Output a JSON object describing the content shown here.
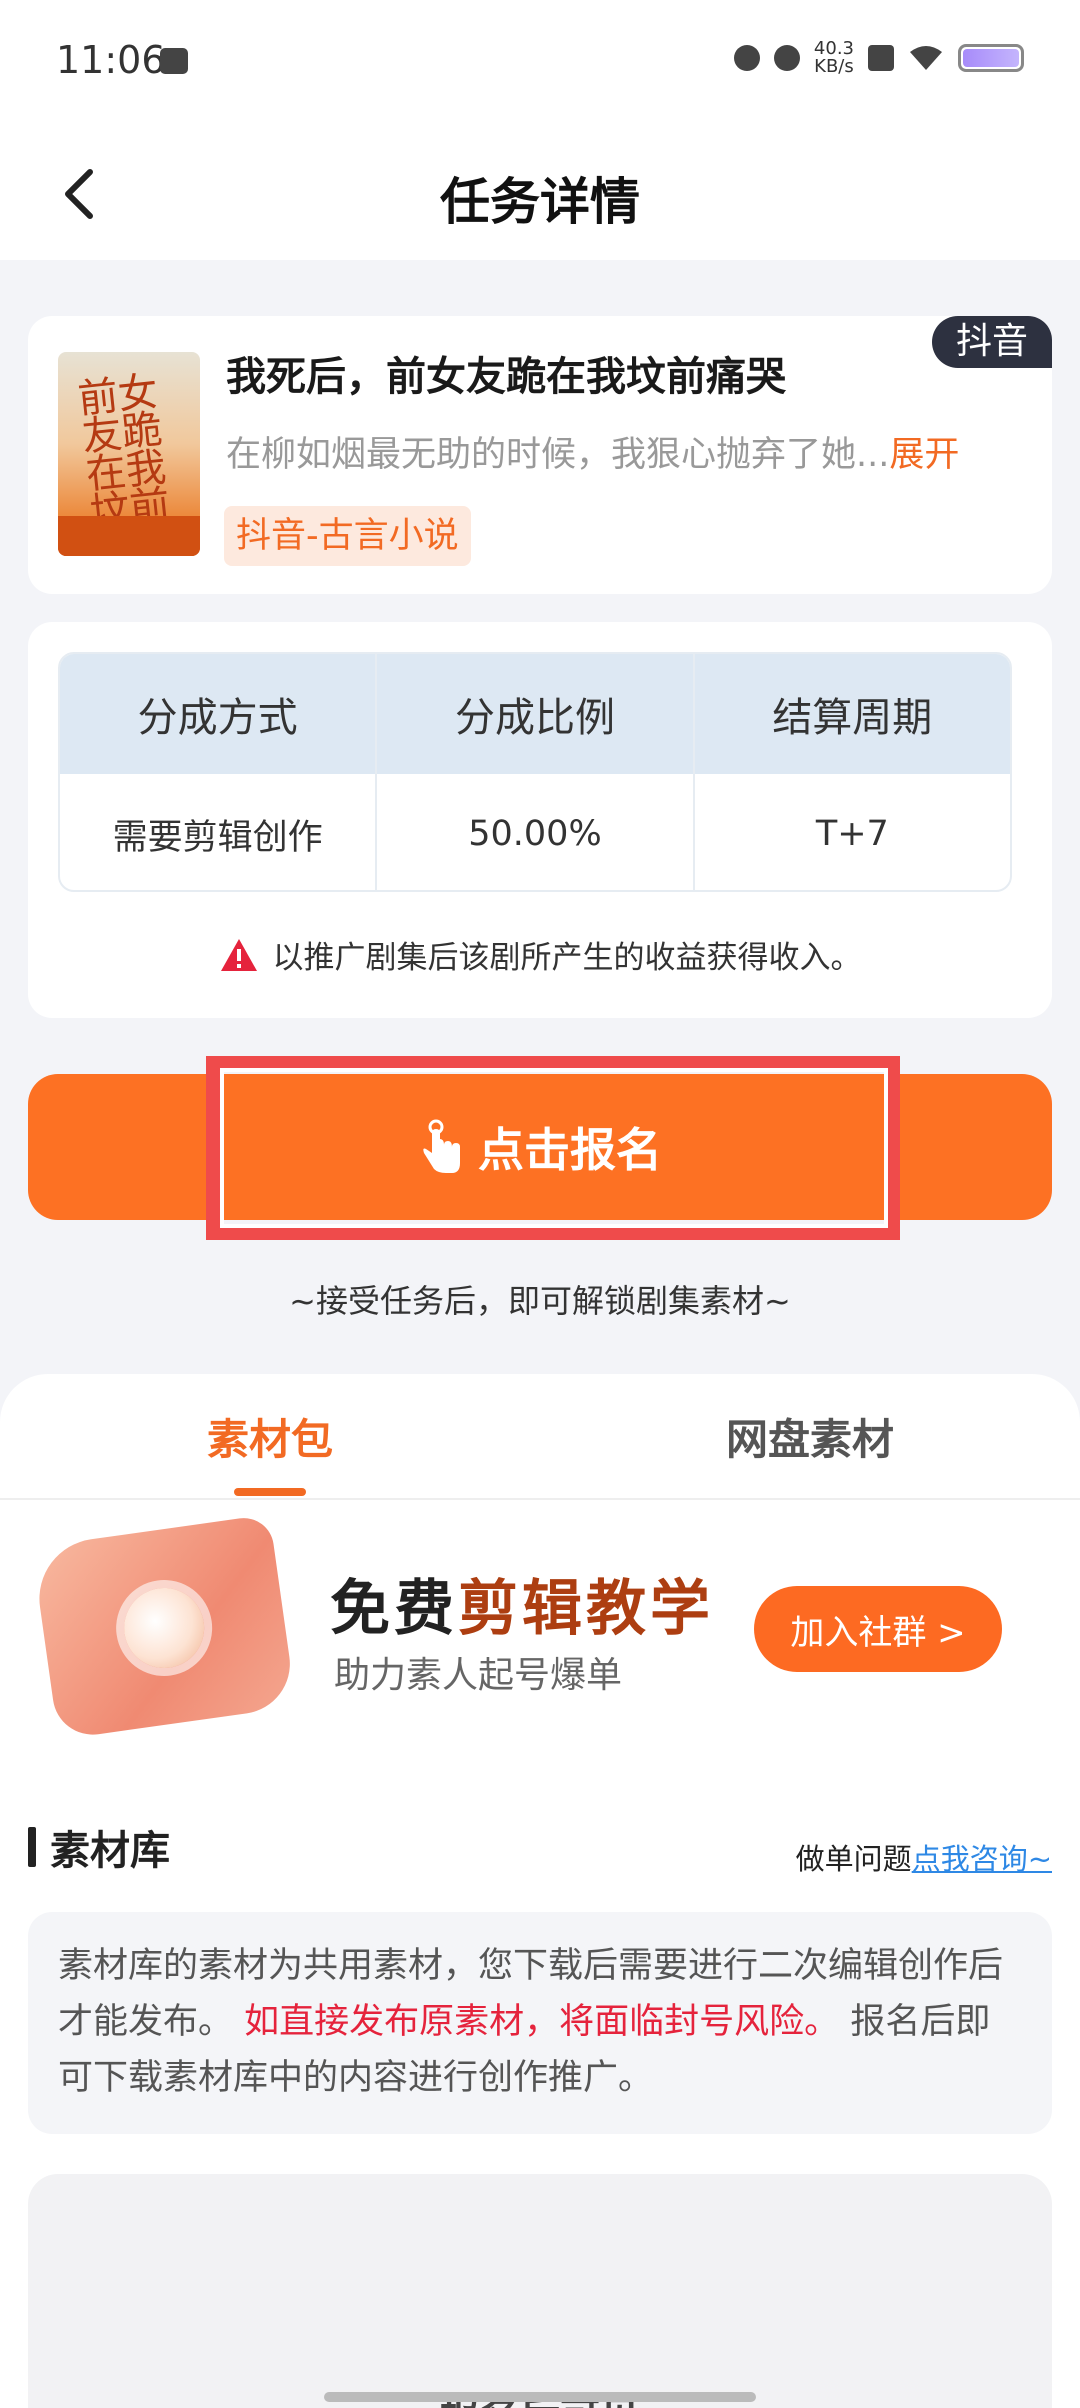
{
  "status_bar": {
    "time": "11:06",
    "net_speed": "40.3\nKB/s"
  },
  "nav": {
    "title": "任务详情"
  },
  "book": {
    "platform_tag": "抖音",
    "cover_text": "前女友跪在我坟前",
    "title": "我死后，前女友跪在我坟前痛哭",
    "description": "在柳如烟最无助的时候，我狠心抛弃了她...",
    "expand_label": "展开",
    "genre": "抖音-古言小说"
  },
  "split": {
    "headers": [
      "分成方式",
      "分成比例",
      "结算周期"
    ],
    "values": [
      "需要剪辑创作",
      "50.00%",
      "T+7"
    ],
    "note": "以推广剧集后该剧所产生的收益获得收入。"
  },
  "signup": {
    "label": "点击报名",
    "hint": "~接受任务后，即可解锁剧集素材~"
  },
  "tabs": [
    {
      "label": "素材包",
      "active": true
    },
    {
      "label": "网盘素材",
      "active": false
    }
  ],
  "banner": {
    "title_prefix": "免费",
    "title_highlight": "剪辑教学",
    "subtitle": "助力素人起号爆单",
    "button": "加入社群 >"
  },
  "library": {
    "title": "素材库",
    "help_prefix": "做单问题",
    "help_link": "点我咨询~",
    "notice_part1": "素材库的素材为共用素材，您下载后需要进行二次编辑创作后才能发布。",
    "notice_danger": "如直接发布原素材，将面临封号风险。",
    "notice_part2": "报名后即可下载素材库中的内容进行创作推广。",
    "locked_text": "报名后可见"
  },
  "colors": {
    "accent": "#fd7123",
    "danger": "#e5233c",
    "link": "#2e88e5",
    "highlight_box": "#ef4b4b"
  }
}
